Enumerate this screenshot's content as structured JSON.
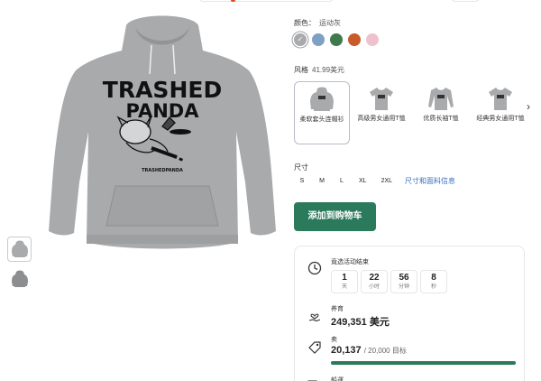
{
  "product": {
    "graphic_title_line1": "TRASHED",
    "graphic_title_line2": "PANDA",
    "graphic_brand": "TRASHEDPANDA"
  },
  "color": {
    "label": "颜色：",
    "selected": "运动灰",
    "swatches": [
      {
        "name": "运动灰",
        "hex": "#a9aaac",
        "selected": true
      },
      {
        "name": "blue",
        "hex": "#7ea0c4",
        "selected": false
      },
      {
        "name": "green",
        "hex": "#3d7a4c",
        "selected": false
      },
      {
        "name": "orange",
        "hex": "#c95a2b",
        "selected": false
      },
      {
        "name": "pink",
        "hex": "#efc1cf",
        "selected": false
      }
    ]
  },
  "style": {
    "label": "风格",
    "price": "41.99美元",
    "options": [
      {
        "label": "柔软套头连帽衫",
        "icon": "hoodie-icon",
        "selected": true
      },
      {
        "label": "高级男女通用T恤",
        "icon": "tshirt-icon",
        "selected": false
      },
      {
        "label": "优质长袖T恤",
        "icon": "longsleeve-icon",
        "selected": false
      },
      {
        "label": "经典男女通用T恤",
        "icon": "tshirt-icon",
        "selected": false
      }
    ]
  },
  "size": {
    "label": "尺寸",
    "options": [
      "S",
      "M",
      "L",
      "XL",
      "2XL"
    ],
    "guide_link": "尺寸和面料信息"
  },
  "cart": {
    "label": "添加到购物车"
  },
  "campaign": {
    "ends_label": "竟选活动结束",
    "countdown": [
      {
        "value": "1",
        "unit": "天"
      },
      {
        "value": "22",
        "unit": "小时"
      },
      {
        "value": "56",
        "unit": "分钟"
      },
      {
        "value": "8",
        "unit": "秒"
      }
    ],
    "raised_label": "养育",
    "raised_value": "249,351 美元",
    "sold_label": "卖",
    "sold_value": "20,137",
    "sold_goal": "/ 20,000 目标",
    "sold_progress_fraction": 1.0,
    "shipping_label": "船運"
  },
  "colors": {
    "accent": "#2b7a5b",
    "link": "#3b6fc4",
    "hoodie": "#a9aaac"
  }
}
